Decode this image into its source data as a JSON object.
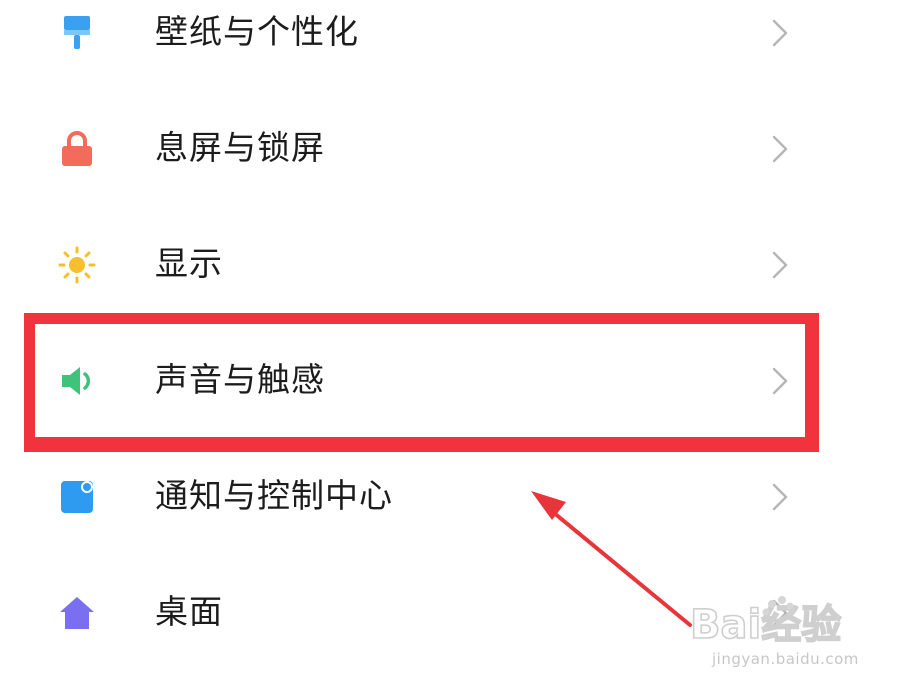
{
  "settings": {
    "items": [
      {
        "label": "壁纸与个性化",
        "icon": "paint-brush-icon",
        "color": "#3aa0f0"
      },
      {
        "label": "息屏与锁屏",
        "icon": "lock-icon",
        "color": "#f26b5b"
      },
      {
        "label": "显示",
        "icon": "sun-icon",
        "color": "#f6bf2e"
      },
      {
        "label": "声音与触感",
        "icon": "speaker-icon",
        "color": "#3fc37a"
      },
      {
        "label": "通知与控制中心",
        "icon": "notification-icon",
        "color": "#2e9af0"
      },
      {
        "label": "桌面",
        "icon": "home-icon",
        "color": "#7a6ff0"
      }
    ]
  },
  "annotation": {
    "highlight_color": "#f0333d",
    "highlighted_item": "声音与触感"
  },
  "watermark": {
    "logo_text": "Bai经验",
    "url_text": "jingyan.baidu.com"
  }
}
